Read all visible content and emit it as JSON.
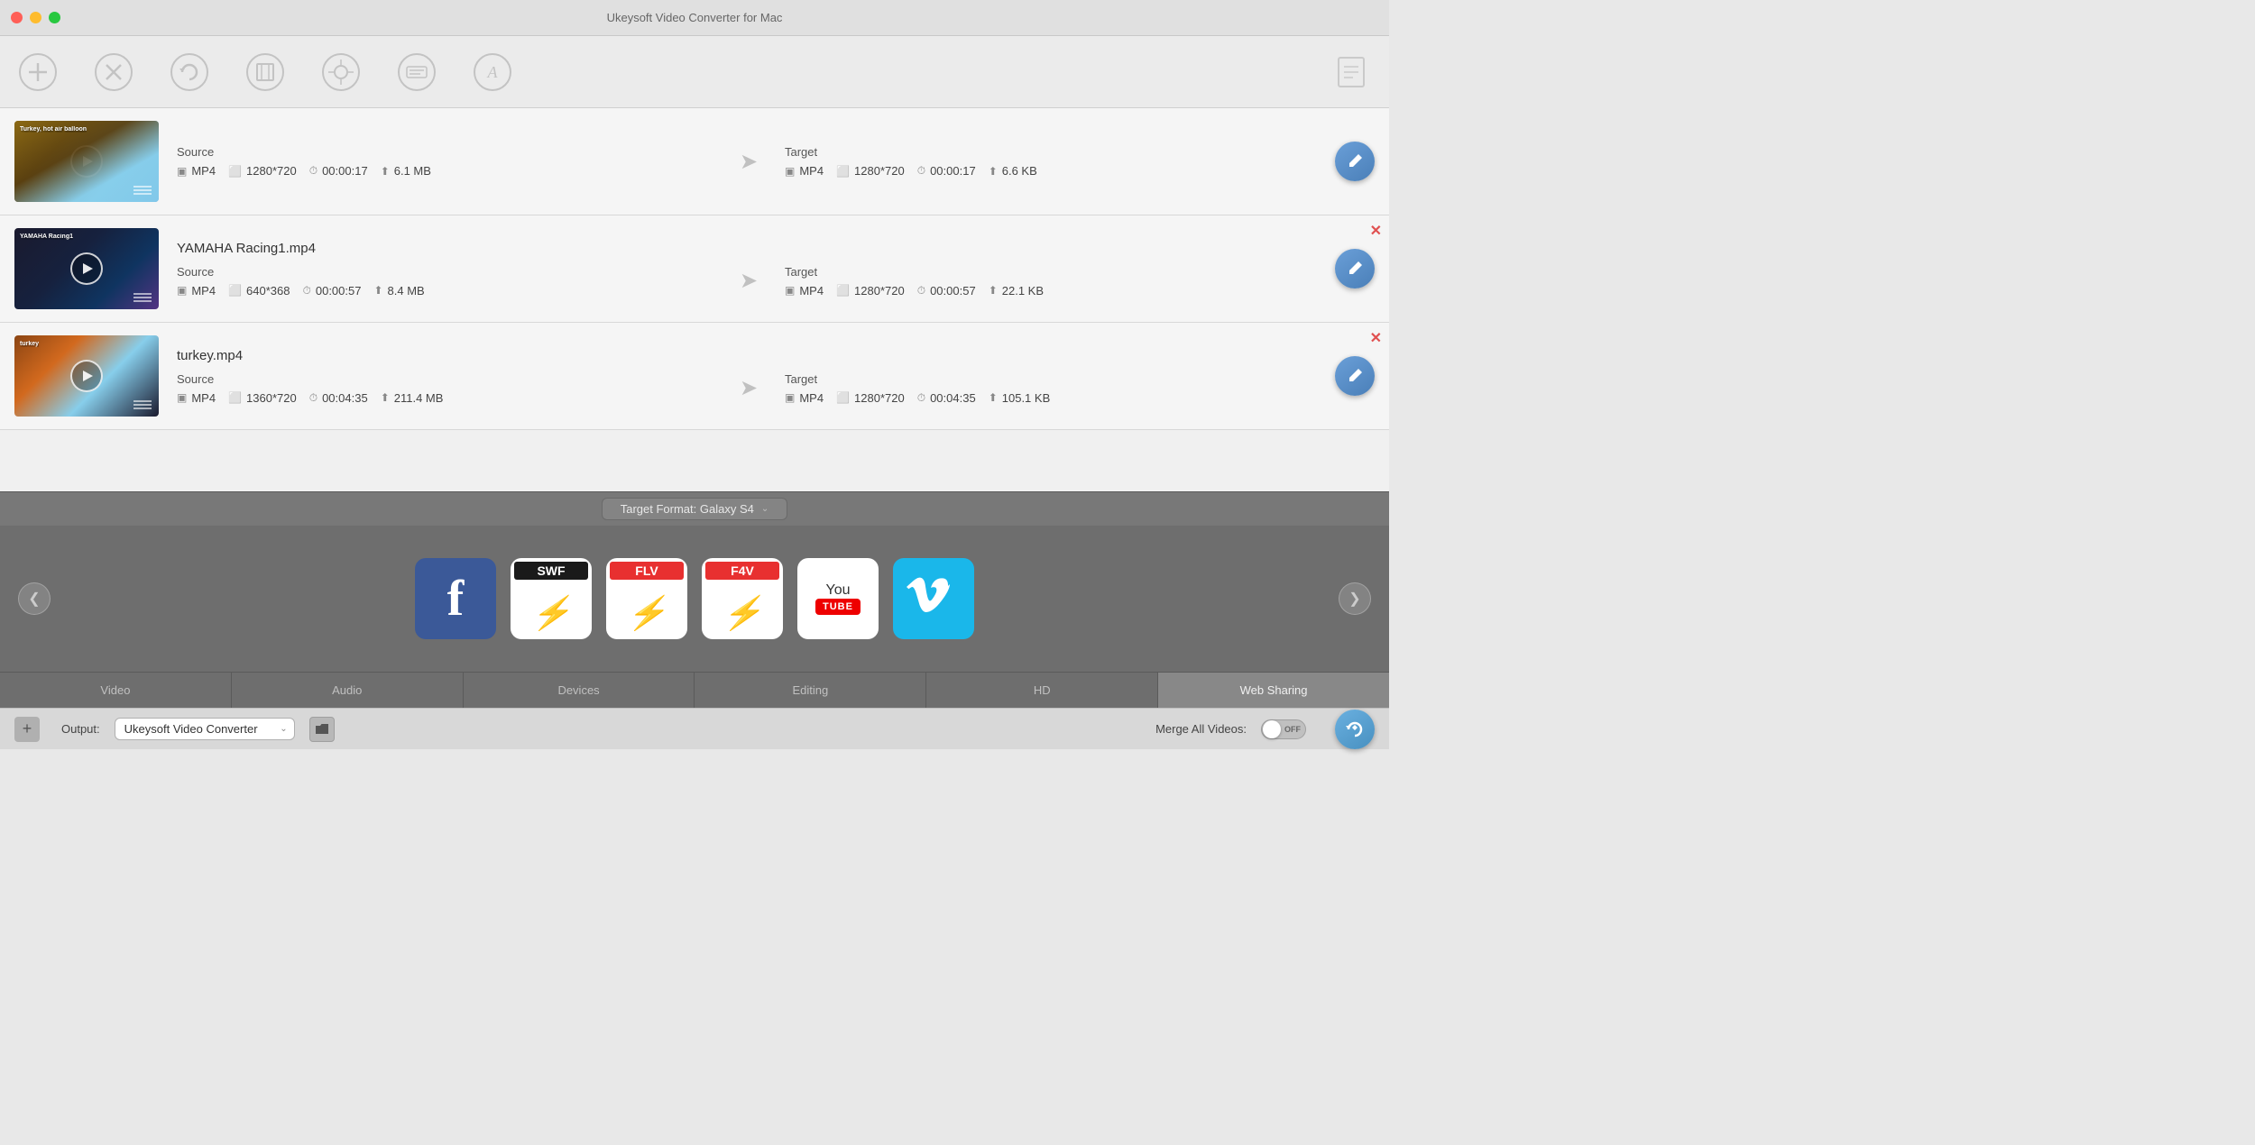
{
  "app": {
    "title": "Ukeysoft Video Converter for Mac"
  },
  "toolbar": {
    "icons": [
      {
        "name": "add-icon",
        "symbol": "+",
        "label": "Add"
      },
      {
        "name": "convert-icon",
        "symbol": "✕",
        "label": "Convert"
      },
      {
        "name": "refresh-icon",
        "symbol": "↺",
        "label": "Refresh"
      },
      {
        "name": "trim-icon",
        "symbol": "⬡",
        "label": "Trim"
      },
      {
        "name": "effect-icon",
        "symbol": "✿",
        "label": "Effect"
      },
      {
        "name": "subtitle-icon",
        "symbol": "T",
        "label": "Subtitle"
      },
      {
        "name": "watermark-icon",
        "symbol": "A",
        "label": "Watermark"
      }
    ],
    "right_icon": {
      "name": "settings-icon",
      "symbol": "📦"
    }
  },
  "videos": [
    {
      "filename": "Turkey, hot air balloon",
      "thumbnail_class": "thumb-1",
      "thumbnail_title": "Turkey, hot air balloon",
      "source": {
        "label": "Source",
        "format": "MP4",
        "resolution": "1280*720",
        "duration": "00:00:17",
        "size": "6.1 MB"
      },
      "target": {
        "label": "Target",
        "format": "MP4",
        "resolution": "1280*720",
        "duration": "00:00:17",
        "size": "6.6 KB"
      },
      "has_close": false
    },
    {
      "filename": "YAMAHA Racing1.mp4",
      "thumbnail_class": "thumb-2",
      "thumbnail_title": "YAMAHA Racing1",
      "source": {
        "label": "Source",
        "format": "MP4",
        "resolution": "640*368",
        "duration": "00:00:57",
        "size": "8.4 MB"
      },
      "target": {
        "label": "Target",
        "format": "MP4",
        "resolution": "1280*720",
        "duration": "00:00:57",
        "size": "22.1 KB"
      },
      "has_close": true
    },
    {
      "filename": "turkey.mp4",
      "thumbnail_class": "thumb-3",
      "thumbnail_title": "turkey",
      "source": {
        "label": "Source",
        "format": "MP4",
        "resolution": "1360*720",
        "duration": "00:04:35",
        "size": "211.4 MB"
      },
      "target": {
        "label": "Target",
        "format": "MP4",
        "resolution": "1280*720",
        "duration": "00:04:35",
        "size": "105.1 KB"
      },
      "has_close": true
    }
  ],
  "bottom_panel": {
    "format_selector": {
      "label": "Target Format: Galaxy S4",
      "arrow": "⌄"
    },
    "format_icons": [
      {
        "id": "facebook",
        "type": "facebook",
        "label": "Facebook"
      },
      {
        "id": "swf",
        "type": "swf",
        "label": "SWF"
      },
      {
        "id": "flv",
        "type": "flv",
        "label": "FLV"
      },
      {
        "id": "f4v",
        "type": "f4v",
        "label": "F4V"
      },
      {
        "id": "youtube",
        "type": "youtube",
        "label": "YouTube"
      },
      {
        "id": "vimeo",
        "type": "vimeo",
        "label": "Vimeo"
      }
    ],
    "category_tabs": [
      {
        "label": "Video",
        "active": false
      },
      {
        "label": "Audio",
        "active": false
      },
      {
        "label": "Devices",
        "active": false
      },
      {
        "label": "Editing",
        "active": false
      },
      {
        "label": "HD",
        "active": false
      },
      {
        "label": "Web Sharing",
        "active": true
      }
    ]
  },
  "status_bar": {
    "add_label": "+",
    "output_label": "Output:",
    "output_value": "Ukeysoft Video Converter",
    "merge_label": "Merge All Videos:",
    "toggle_state": "OFF"
  }
}
